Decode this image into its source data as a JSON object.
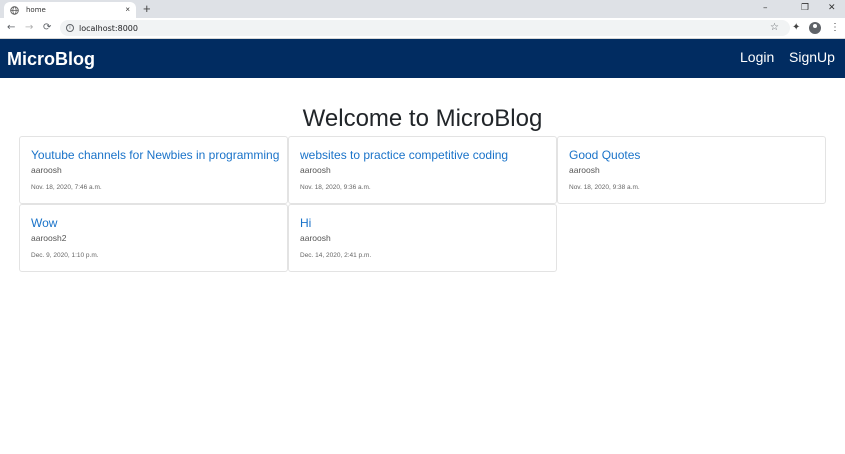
{
  "browser": {
    "tab_title": "home",
    "new_tab": "+",
    "close_tab": "×",
    "url": "localhost:8000",
    "window_controls": {
      "minimize": "–",
      "restore": "❐",
      "close": "✕"
    },
    "nav": {
      "back": "←",
      "forward": "→",
      "reload": "⟳"
    },
    "star": "☆",
    "extensions": "✦",
    "menu": "⋮"
  },
  "navbar": {
    "brand": "MicroBlog",
    "links": [
      "Login",
      "SignUp"
    ]
  },
  "main": {
    "heading": "Welcome to MicroBlog",
    "posts": [
      {
        "title": "Youtube channels for Newbies in programming",
        "author": "aaroosh",
        "date": "Nov. 18, 2020, 7:46 a.m."
      },
      {
        "title": "websites to practice competitive coding",
        "author": "aaroosh",
        "date": "Nov. 18, 2020, 9:36 a.m."
      },
      {
        "title": "Good Quotes",
        "author": "aaroosh",
        "date": "Nov. 18, 2020, 9:38 a.m."
      },
      {
        "title": "Wow",
        "author": "aaroosh2",
        "date": "Dec. 9, 2020, 1:10 p.m."
      },
      {
        "title": "Hi",
        "author": "aaroosh",
        "date": "Dec. 14, 2020, 2:41 p.m."
      }
    ]
  },
  "colors": {
    "navbar": "#012c61",
    "link": "#1a73c9"
  }
}
